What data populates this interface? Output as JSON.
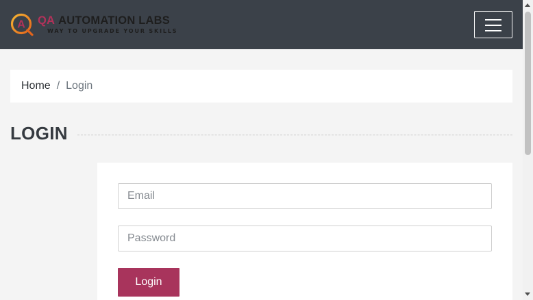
{
  "header": {
    "logo": {
      "initial": "A",
      "title_prefix": "QA",
      "title_main": "AUTOMATION LABS",
      "tagline": "WAY TO UPGRADE YOUR SKILLS"
    },
    "menu_icon": "hamburger-menu-icon"
  },
  "breadcrumb": {
    "home": "Home",
    "separator": "/",
    "current": "Login"
  },
  "page": {
    "title": "LOGIN"
  },
  "form": {
    "email_placeholder": "Email",
    "email_value": "",
    "password_placeholder": "Password",
    "password_value": "",
    "submit_label": "Login"
  },
  "colors": {
    "header_bg": "#3b4149",
    "accent": "#a8345c",
    "page_bg": "#f4f4f4",
    "logo_orange": "#f39a21"
  }
}
